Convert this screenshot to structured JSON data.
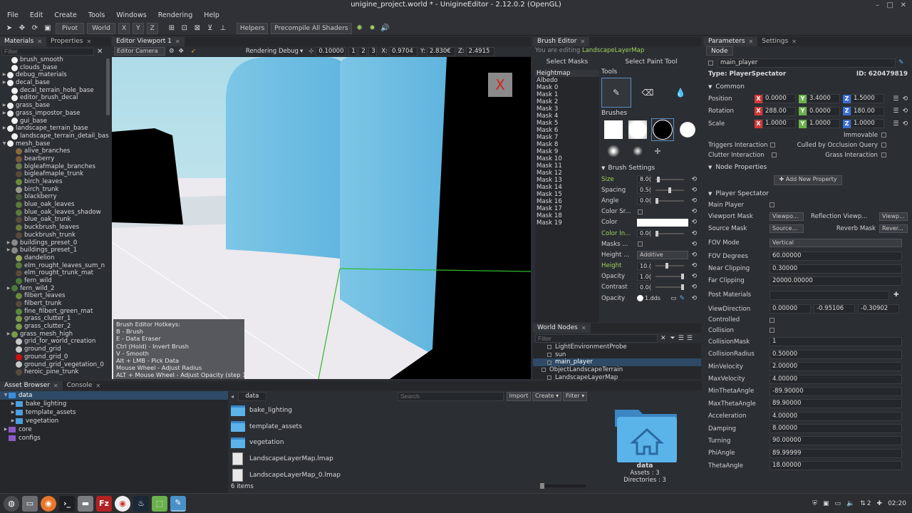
{
  "window": {
    "title": "unigine_project.world * - UnigineEditor - 2.12.0.2 (OpenGL)"
  },
  "menu": [
    "File",
    "Edit",
    "Create",
    "Tools",
    "Windows",
    "Rendering",
    "Help"
  ],
  "toolbar": {
    "pivot": "Pivot",
    "world": "World",
    "x": "X",
    "y": "Y",
    "z": "Z",
    "helpers": "Helpers",
    "precompile": "Precompile All Shaders"
  },
  "materials": {
    "tabs": [
      "Materials",
      "Properties"
    ],
    "filter_placeholder": "Filter",
    "items": [
      {
        "label": "brush_smooth",
        "sw": "#f0f0f0",
        "indent": 1,
        "arrow": ""
      },
      {
        "label": "clouds_base",
        "sw": "#f0f0f0",
        "indent": 1,
        "arrow": ""
      },
      {
        "label": "debug_materials",
        "sw": "#f0f0f0",
        "indent": 0,
        "arrow": "▶"
      },
      {
        "label": "decal_base",
        "sw": "#f0f0f0",
        "indent": 0,
        "arrow": "▶"
      },
      {
        "label": "decal_terrain_hole_base",
        "sw": "#f0f0f0",
        "indent": 1,
        "arrow": ""
      },
      {
        "label": "editor_brush_decal",
        "sw": "#f0f0f0",
        "indent": 1,
        "arrow": ""
      },
      {
        "label": "grass_base",
        "sw": "#f0f0f0",
        "indent": 0,
        "arrow": "▶"
      },
      {
        "label": "grass_impostor_base",
        "sw": "#f0f0f0",
        "indent": 0,
        "arrow": "▶"
      },
      {
        "label": "gui_base",
        "sw": "#f0f0f0",
        "indent": 1,
        "arrow": ""
      },
      {
        "label": "landscape_terrain_base",
        "sw": "#f0f0f0",
        "indent": 0,
        "arrow": "▶"
      },
      {
        "label": "landscape_terrain_detail_bas",
        "sw": "#f0f0f0",
        "indent": 1,
        "arrow": ""
      },
      {
        "label": "mesh_base",
        "sw": "#f0f0f0",
        "indent": 0,
        "arrow": "▼"
      },
      {
        "label": "alive_branches",
        "sw": "#8a6a3a",
        "indent": 2,
        "arrow": ""
      },
      {
        "label": "bearberry",
        "sw": "#7a5a3a",
        "indent": 2,
        "arrow": ""
      },
      {
        "label": "bigleafmaple_branches",
        "sw": "#6a7a4a",
        "indent": 2,
        "arrow": ""
      },
      {
        "label": "bigleafmaple_trunk",
        "sw": "#5a4a3a",
        "indent": 2,
        "arrow": ""
      },
      {
        "label": "birch_leaves",
        "sw": "#6a8a3a",
        "indent": 2,
        "arrow": ""
      },
      {
        "label": "birch_trunk",
        "sw": "#9a9a8a",
        "indent": 2,
        "arrow": ""
      },
      {
        "label": "blackberry",
        "sw": "#4a5a3a",
        "indent": 2,
        "arrow": ""
      },
      {
        "label": "blue_oak_leaves",
        "sw": "#5a7a3a",
        "indent": 2,
        "arrow": ""
      },
      {
        "label": "blue_oak_leaves_shadow",
        "sw": "#5a7a3a",
        "indent": 2,
        "arrow": ""
      },
      {
        "label": "blue_oak_trunk",
        "sw": "#5a4a3a",
        "indent": 2,
        "arrow": ""
      },
      {
        "label": "buckbrush_leaves",
        "sw": "#6a7a3a",
        "indent": 2,
        "arrow": ""
      },
      {
        "label": "buckbrush_trunk",
        "sw": "#5a4a3a",
        "indent": 2,
        "arrow": ""
      },
      {
        "label": "buildings_preset_0",
        "sw": "#8a8a8a",
        "indent": 1,
        "arrow": "▶"
      },
      {
        "label": "buildings_preset_1",
        "sw": "#8a8a8a",
        "indent": 1,
        "arrow": "▶"
      },
      {
        "label": "dandelion",
        "sw": "#9aaa5a",
        "indent": 2,
        "arrow": ""
      },
      {
        "label": "elm_rought_leaves_sum_n",
        "sw": "#5a7a3a",
        "indent": 2,
        "arrow": ""
      },
      {
        "label": "elm_rought_trunk_mat",
        "sw": "#5a4a3a",
        "indent": 2,
        "arrow": ""
      },
      {
        "label": "fern_wild",
        "sw": "#4a7a3a",
        "indent": 2,
        "arrow": ""
      },
      {
        "label": "fern_wild_2",
        "sw": "#4a7a3a",
        "indent": 1,
        "arrow": "▶"
      },
      {
        "label": "filbert_leaves",
        "sw": "#6a8a3a",
        "indent": 2,
        "arrow": ""
      },
      {
        "label": "filbert_trunk",
        "sw": "#5a4a3a",
        "indent": 2,
        "arrow": ""
      },
      {
        "label": "fine_filbert_green_mat",
        "sw": "#5a8a3a",
        "indent": 2,
        "arrow": ""
      },
      {
        "label": "grass_clutter_1",
        "sw": "#7a9a4a",
        "indent": 2,
        "arrow": ""
      },
      {
        "label": "grass_clutter_2",
        "sw": "#7a9a4a",
        "indent": 2,
        "arrow": ""
      },
      {
        "label": "grass_mesh_high",
        "sw": "#7a9a4a",
        "indent": 1,
        "arrow": "▶"
      },
      {
        "label": "grid_for_world_creation",
        "sw": "#c8c8c8",
        "indent": 2,
        "arrow": ""
      },
      {
        "label": "ground_grid",
        "sw": "#c8c8c8",
        "indent": 2,
        "arrow": ""
      },
      {
        "label": "ground_grid_0",
        "sw": "#d01010",
        "indent": 2,
        "arrow": ""
      },
      {
        "label": "ground_grid_vegetation_0",
        "sw": "#c8c8c8",
        "indent": 2,
        "arrow": ""
      },
      {
        "label": "heroic_pine_trunk",
        "sw": "#5a4a3a",
        "indent": 2,
        "arrow": ""
      }
    ]
  },
  "viewport": {
    "tab": "Editor Viewport 1",
    "camera": "Editor Camera",
    "rendering_debug": "Rendering Debug",
    "speed": "0.10000",
    "speeds": [
      "1",
      "2",
      "3"
    ],
    "x_label": "X:",
    "x_val": "0.9704",
    "y_label": "Y:",
    "y_val": "2.830€",
    "z_label": "Z:",
    "z_val": "2.4915",
    "close_mark": "X",
    "hotkeys": [
      "Brush Editor Hotkeys:",
      "B - Brush",
      "E - Data Eraser",
      "Ctrl (Hold) - Invert Brush",
      "V - Smooth",
      "Alt + LMB - Pick Data",
      "Mouse Wheel - Adjust Radius",
      "ALT + Mouse Wheel -  Adjust Opacity (step 1)",
      "ALT + Ctrl + Mouse Wheel - Adjust Opacity (st"
    ]
  },
  "brush_editor": {
    "tab": "Brush Editor",
    "editing_prefix": "You are editing",
    "editing_target": "LandscapeLayerMap",
    "select_masks": "Select Masks",
    "select_paint_tool": "Select Paint Tool",
    "masks": [
      "Heightmap",
      "Albedo",
      "Mask 0",
      "Mask 1",
      "Mask 2",
      "Mask 3",
      "Mask 4",
      "Mask 5",
      "Mask 6",
      "Mask 7",
      "Mask 8",
      "Mask 9",
      "Mask 10",
      "Mask 11",
      "Mask 12",
      "Mask 13",
      "Mask 14",
      "Mask 15",
      "Mask 16",
      "Mask 17",
      "Mask 18",
      "Mask 19"
    ],
    "tools_label": "Tools",
    "brushes_label": "Brushes",
    "settings_label": "Brush Settings",
    "settings": [
      {
        "label": "Size",
        "value": "8.0(",
        "hl": true,
        "slider": 0.05
      },
      {
        "label": "Spacing",
        "value": "0.5(",
        "hl": false,
        "slider": 0.5
      },
      {
        "label": "Angle",
        "value": "0.0(",
        "hl": false,
        "slider": 0.0
      },
      {
        "label": "Color Sr...",
        "value": "",
        "hl": false,
        "kind": "check"
      },
      {
        "label": "Color",
        "value": "",
        "hl": false,
        "kind": "color"
      },
      {
        "label": "Color In...",
        "value": "0.0(",
        "hl": true,
        "slider": 0.0
      },
      {
        "label": "Masks ...",
        "value": "",
        "hl": false,
        "kind": "check"
      },
      {
        "label": "Height ...",
        "value": "Additive",
        "hl": false,
        "kind": "combo"
      },
      {
        "label": "Height",
        "value": "10.(",
        "hl": true,
        "slider": 0.4
      },
      {
        "label": "Opacity",
        "value": "1.0(",
        "hl": false,
        "slider": 1.0
      },
      {
        "label": "Contrast",
        "value": "0.0(",
        "hl": false,
        "slider": 1.0
      },
      {
        "label": "Opacity",
        "value": "1.dds",
        "hl": false,
        "kind": "file"
      }
    ]
  },
  "world_nodes": {
    "tab": "World Nodes",
    "filter_placeholder": "Filter",
    "items": [
      {
        "label": "LightEnvironmentProbe",
        "indent": 2,
        "sel": false
      },
      {
        "label": "sun",
        "indent": 2,
        "sel": false
      },
      {
        "label": "main_player",
        "indent": 2,
        "sel": true
      },
      {
        "label": "ObjectLandscapeTerrain",
        "indent": 1,
        "sel": false
      },
      {
        "label": "LandscapeLayerMap",
        "indent": 2,
        "sel": false
      }
    ]
  },
  "params": {
    "tabs": [
      "Parameters",
      "Settings"
    ],
    "subtab": "Node",
    "name": "main_player",
    "type_label": "Type:",
    "type": "PlayerSpectator",
    "id_label": "ID:",
    "id": "620479819",
    "common": "Common",
    "position_label": "Position",
    "position": [
      "0.0000",
      "3.4000",
      "1.5000"
    ],
    "rotation_label": "Rotation",
    "rotation": [
      "288.00",
      "0.0000",
      "180.00"
    ],
    "scale_label": "Scale",
    "scale": [
      "1.0000",
      "1.0000",
      "1.0000"
    ],
    "immovable": "Immovable",
    "triggers": "Triggers Interaction",
    "culled": "Culled by Occlusion Query",
    "clutter": "Clutter Interaction",
    "grass": "Grass Interaction",
    "node_properties": "Node Properties",
    "add_property": "Add New Property",
    "player_spectator": "Player Spectator",
    "main_player_label": "Main Player",
    "viewport_mask": "Viewport Mask",
    "viewport_mask_val": "Viewpo...",
    "reflection_viewport": "Reflection Viewp...",
    "reflection_viewport_val": "Viewp...",
    "source_mask": "Source Mask",
    "source_mask_val": "Source...",
    "reverb_mask": "Reverb Mask",
    "reverb_mask_val": "Rever...",
    "fov_mode": "FOV Mode",
    "fov_mode_val": "Vertical",
    "fields1": [
      {
        "label": "FOV Degrees",
        "value": "60.00000"
      },
      {
        "label": "Near Clipping",
        "value": "0.30000"
      },
      {
        "label": "Far Clipping",
        "value": "20000.00000"
      }
    ],
    "post_materials": "Post Materials",
    "view_direction": "ViewDirection",
    "view_direction_vals": [
      "0.00000",
      "-0.95106",
      "-0.30902"
    ],
    "controlled": "Controlled",
    "collision": "Collision",
    "fields2": [
      {
        "label": "CollisionMask",
        "value": "1"
      },
      {
        "label": "CollisionRadius",
        "value": "0.50000"
      },
      {
        "label": "MinVelocity",
        "value": "2.00000"
      },
      {
        "label": "MaxVelocity",
        "value": "4.00000"
      },
      {
        "label": "MinThetaAngle",
        "value": "-89.90000"
      },
      {
        "label": "MaxThetaAngle",
        "value": "89.90000"
      },
      {
        "label": "Acceleration",
        "value": "4.00000"
      },
      {
        "label": "Damping",
        "value": "8.00000"
      },
      {
        "label": "Turning",
        "value": "90.00000"
      },
      {
        "label": "PhiAngle",
        "value": "89.99999"
      },
      {
        "label": "ThetaAngle",
        "value": "18.00000"
      }
    ]
  },
  "asset_browser": {
    "tabs": [
      "Asset Browser",
      "Console"
    ],
    "tree": [
      {
        "label": "data",
        "indent": 0,
        "arrow": "▼",
        "color": "#3a8ee0",
        "sel": true
      },
      {
        "label": "bake_lighting",
        "indent": 1,
        "arrow": "▶",
        "color": "#4aa0e0",
        "sel": false
      },
      {
        "label": "template_assets",
        "indent": 1,
        "arrow": "▶",
        "color": "#4aa0e0",
        "sel": false
      },
      {
        "label": "vegetation",
        "indent": 1,
        "arrow": "▶",
        "color": "#4aa0e0",
        "sel": false
      },
      {
        "label": "core",
        "indent": 0,
        "arrow": "▶",
        "color": "#8a5ac8",
        "sel": false
      },
      {
        "label": "configs",
        "indent": 0,
        "arrow": "",
        "color": "#8a5ac8",
        "sel": false
      }
    ],
    "breadcrumb": "data",
    "search_placeholder": "Search",
    "import": "Import",
    "create": "Create",
    "filter": "Filter",
    "files": [
      {
        "label": "bake_lighting",
        "kind": "folder"
      },
      {
        "label": "template_assets",
        "kind": "folder"
      },
      {
        "label": "vegetation",
        "kind": "folder"
      },
      {
        "label": "LandscapeLayerMap.lmap",
        "kind": "file"
      },
      {
        "label": "LandscapeLayerMap_0.lmap",
        "kind": "file"
      }
    ],
    "count": "6 items",
    "preview_name": "data",
    "preview_assets": "Assets : 3",
    "preview_dirs": "Directories : 3"
  },
  "taskbar": {
    "time": "02:20",
    "workspace": "2"
  }
}
